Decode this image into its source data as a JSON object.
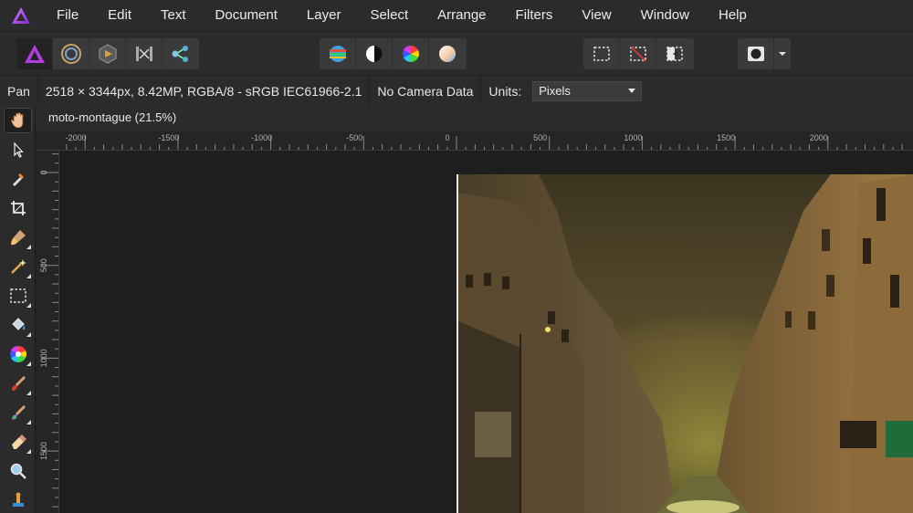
{
  "menu": {
    "items": [
      "File",
      "Edit",
      "Text",
      "Document",
      "Layer",
      "Select",
      "Arrange",
      "Filters",
      "View",
      "Window",
      "Help"
    ]
  },
  "toolbar": {
    "personas": [
      "photo-persona-icon",
      "liquify-persona-icon",
      "develop-persona-icon",
      "tone-mapping-persona-icon",
      "export-persona-icon"
    ],
    "adjustments": [
      "auto-levels-icon",
      "auto-contrast-icon",
      "auto-colors-icon",
      "auto-white-balance-icon"
    ],
    "selection": [
      "marquee-selection-icon",
      "deselect-icon",
      "invert-selection-icon"
    ],
    "mask": [
      "quick-mask-icon",
      "dropdown-arrow-icon"
    ]
  },
  "context": {
    "tool_name": "Pan",
    "doc_info": "2518 × 3344px, 8.42MP, RGBA/8 - sRGB IEC61966-2.1",
    "camera": "No Camera Data",
    "units_label": "Units:",
    "units_value": "Pixels"
  },
  "tools": [
    "hand-tool-icon",
    "move-tool-icon",
    "color-picker-icon",
    "crop-tool-icon",
    "selection-brush-icon",
    "magic-wand-icon",
    "rectangular-marquee-icon",
    "flood-fill-icon",
    "gradient-tool-icon",
    "paint-brush-icon",
    "color-replacement-brush-icon",
    "erase-brush-icon",
    "zoom-tool-icon",
    "clone-brush-icon"
  ],
  "document": {
    "tab_title": "moto-montague (21.5%)"
  },
  "rulers": {
    "unit": "px",
    "h_labels": [
      "-2000",
      "-1500",
      "-1000",
      "-500",
      "0",
      "500",
      "1000",
      "1500",
      "2000"
    ],
    "v_labels": [
      "0",
      "500",
      "1000",
      "1500"
    ]
  },
  "colors": {
    "accent": "#a93bd6",
    "panel": "#2b2b2b",
    "canvas": "#1e1e1e"
  }
}
